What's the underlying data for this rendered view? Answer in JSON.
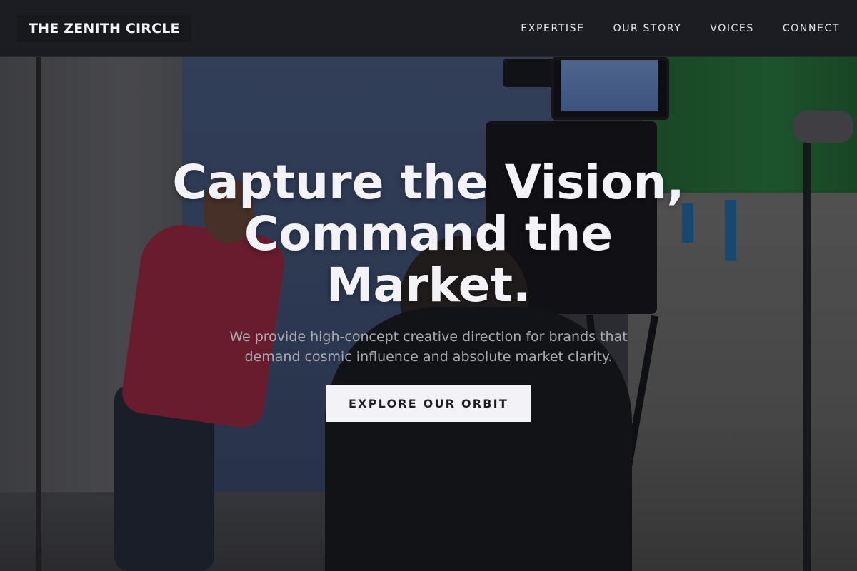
{
  "header": {
    "logo": "THE ZENITH CIRCLE",
    "nav": [
      {
        "label": "EXPERTISE"
      },
      {
        "label": "OUR STORY"
      },
      {
        "label": "VOICES"
      },
      {
        "label": "CONNECT"
      }
    ]
  },
  "hero": {
    "title": "Capture the Vision, Command the Market.",
    "subtitle": "We provide high-concept creative direction for brands that demand cosmic influence and absolute market clarity.",
    "cta_label": "EXPLORE OUR ORBIT",
    "background_image": "film-set-camera-crew-photo"
  },
  "colors": {
    "header_bg": "#1c1d22",
    "text_light": "#f3f2f7",
    "subtitle_text": "#a9aab1",
    "cta_bg": "#f3f2f7",
    "cta_text": "#1c1d22"
  }
}
